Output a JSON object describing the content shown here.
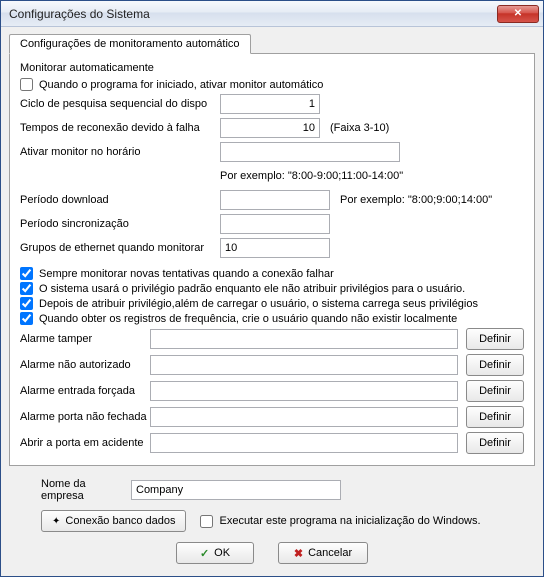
{
  "window": {
    "title": "Configurações do Sistema"
  },
  "tab": {
    "label": "Configurações de monitoramento automático"
  },
  "section": {
    "title": "Monitorar automaticamente"
  },
  "auto_start": {
    "label": "Quando o programa for iniciado, ativar monitor automático",
    "checked": false
  },
  "poll_cycle": {
    "label": "Ciclo de pesquisa sequencial do dispo",
    "value": "1"
  },
  "reconnect": {
    "label": "Tempos de reconexão devido à falha",
    "value": "10",
    "range": "(Faixa 3-10)"
  },
  "activate_time": {
    "label": "Ativar monitor no horário",
    "value": "",
    "example": "Por exemplo: \"8:00-9:00;11:00-14:00\""
  },
  "download_period": {
    "label": "Período download",
    "value": "",
    "example": "Por exemplo: \"8:00;9:00;14:00\""
  },
  "sync_period": {
    "label": "Período sincronização",
    "value": ""
  },
  "eth_groups": {
    "label": "Grupos de ethernet quando monitorar",
    "value": "10"
  },
  "checks": {
    "c1": {
      "label": "Sempre monitorar novas tentativas quando a conexão falhar",
      "checked": true
    },
    "c2": {
      "label": "O sistema usará o privilégio padrão enquanto ele não atribuir privilégios para o usuário.",
      "checked": true
    },
    "c3": {
      "label": "Depois de atribuir privilégio,além de carregar o usuário, o sistema carrega seus privilégios",
      "checked": true
    },
    "c4": {
      "label": "Quando obter os registros de frequência, crie o usuário quando não existir localmente",
      "checked": true
    }
  },
  "alarms": {
    "tamper": {
      "label": "Alarme tamper",
      "value": "",
      "btn": "Definir"
    },
    "unauthorized": {
      "label": "Alarme não autorizado",
      "value": "",
      "btn": "Definir"
    },
    "forced": {
      "label": "Alarme entrada forçada",
      "value": "",
      "btn": "Definir"
    },
    "door_open": {
      "label": "Alarme porta não fechada",
      "value": "",
      "btn": "Definir"
    },
    "accident": {
      "label": "Abrir a porta em acidente",
      "value": "",
      "btn": "Definir"
    }
  },
  "company": {
    "label": "Nome da empresa",
    "value": "Company"
  },
  "db_btn": "Conexão banco dados",
  "run_startup": {
    "label": "Executar este programa na inicialização do Windows.",
    "checked": false
  },
  "ok": "OK",
  "cancel": "Cancelar"
}
